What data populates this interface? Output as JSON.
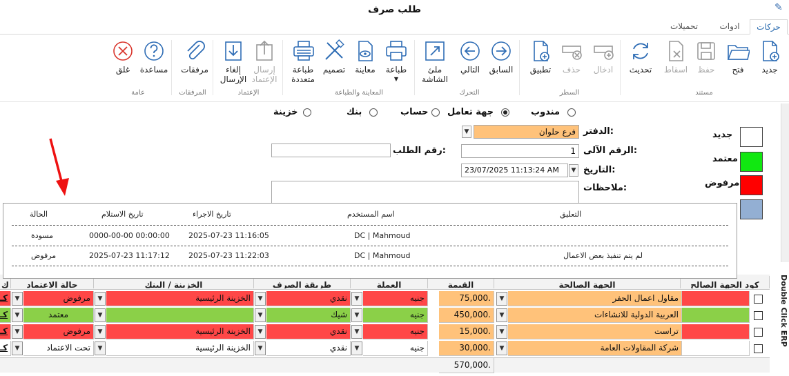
{
  "window": {
    "title": "طلب صرف"
  },
  "tabs": [
    "حركات",
    "ادوات",
    "تحميلات"
  ],
  "ribbon": {
    "buttons": [
      {
        "label": "جديد",
        "icon": "new-document-icon",
        "enabled": true
      },
      {
        "label": "فتح",
        "icon": "folder-open-icon",
        "enabled": true
      },
      {
        "label": "حفظ",
        "icon": "save-icon",
        "enabled": false
      },
      {
        "label": "اسقاط",
        "icon": "discard-icon",
        "enabled": false
      },
      {
        "label": "تحديث",
        "icon": "refresh-icon",
        "enabled": true
      },
      {
        "label": "ادخال",
        "icon": "insert-row-icon",
        "enabled": false
      },
      {
        "label": "حذف",
        "icon": "delete-row-icon",
        "enabled": false
      },
      {
        "label": "تطبيق",
        "icon": "apply-icon",
        "enabled": true
      },
      {
        "label": "السابق",
        "icon": "arrow-right-icon",
        "enabled": true
      },
      {
        "label": "التالي",
        "icon": "arrow-left-icon",
        "enabled": true
      },
      {
        "label": "ملئ\nالشاشة",
        "icon": "fullscreen-icon",
        "enabled": true
      },
      {
        "label": "طباعة",
        "icon": "printer-icon",
        "enabled": true
      },
      {
        "label": "معاينة",
        "icon": "preview-icon",
        "enabled": true
      },
      {
        "label": "تصميم",
        "icon": "design-icon",
        "enabled": true
      },
      {
        "label": "طباعة\nمتعددة",
        "icon": "multi-print-icon",
        "enabled": true
      },
      {
        "label": "إرسال\nالإعتماد",
        "icon": "send-approval-icon",
        "enabled": false
      },
      {
        "label": "إلغاء\nالإرسال",
        "icon": "cancel-send-icon",
        "enabled": true
      },
      {
        "label": "مرفقات",
        "icon": "paperclip-icon",
        "enabled": true
      },
      {
        "label": "مساعدة",
        "icon": "help-icon",
        "enabled": true
      },
      {
        "label": "غلق",
        "icon": "close-icon",
        "enabled": true
      }
    ],
    "groups": [
      "مستند",
      "السطر",
      "التحرك",
      "المعاينة والطباعة",
      "الإعتماد",
      "المرفقات",
      "عامة"
    ]
  },
  "form": {
    "radios": [
      {
        "label": "مندوب",
        "checked": false
      },
      {
        "label": "جهة تعامل",
        "checked": true
      },
      {
        "label": "حساب",
        "checked": false
      },
      {
        "label": "بنك",
        "checked": false
      },
      {
        "label": "خزينة",
        "checked": false
      }
    ],
    "ledger_label": "الدفتر:",
    "ledger_value": "فرع حلوان",
    "auto_no_label": "الرقم الآلى:",
    "auto_no_value": "1",
    "request_no_label": "رقم الطلب:",
    "request_no_value": "",
    "date_label": "التاريخ:",
    "date_value": "23/07/2025 11:13:24 AM",
    "notes_label": "ملاحظات:",
    "notes_value": ""
  },
  "legend": [
    {
      "label": "جديد",
      "color": "#ffffff"
    },
    {
      "label": "معتمد",
      "color": "#11e811"
    },
    {
      "label": "مرفوض",
      "color": "#ff0000"
    },
    {
      "label": "",
      "color": "#93afd3"
    }
  ],
  "popup": {
    "headers": {
      "comment": "التعليق",
      "user": "اسم المستخدم",
      "exec_date": "تاريخ الاجراء",
      "recv_date": "تاريخ الاستلام",
      "status": "الحالة"
    },
    "rows": [
      {
        "comment": "",
        "user": "DC | Mahmoud",
        "exec_date": "2025-07-23 11:16:05",
        "recv_date": "0000-00-00 00:00:00",
        "status": "مسودة"
      },
      {
        "comment": "لم يتم تنفيذ بعض الاعمال",
        "user": "DC | Mahmoud",
        "exec_date": "2025-07-23 11:22:03",
        "recv_date": "2025-07-23 11:17:12",
        "status": "مرفوض"
      }
    ]
  },
  "grid": {
    "headers": {
      "code": "كود الجهة الصالح",
      "party": "الجهة الصالحة",
      "amount": "القيمة",
      "currency": "العملة",
      "pay_method": "طريقة الصرف",
      "treasury": "الخزينة / البنك",
      "approval": "حالة الاعتماد",
      "extra": "ك"
    },
    "rows": [
      {
        "party": "مقاول اعمال الحفر",
        "amount": "75,000.",
        "currency": "جنيه",
        "pay_method": "نقدي",
        "treasury": "الخزينة الرئيسية",
        "approval": "مرفوض",
        "extra": "كـ",
        "color": "red"
      },
      {
        "party": "العربية الدولية للانشاءات",
        "amount": "450,000.",
        "currency": "جنيه",
        "pay_method": "شيك",
        "treasury": "",
        "approval": "معتمد",
        "extra": "كـ",
        "color": "green"
      },
      {
        "party": "تراست",
        "amount": "15,000.",
        "currency": "جنيه",
        "pay_method": "نقدي",
        "treasury": "الخزينة الرئيسية",
        "approval": "مرفوض",
        "extra": "كـ",
        "color": "red"
      },
      {
        "party": "شركة المقاولات العامة",
        "amount": "30,000.",
        "currency": "جنيه",
        "pay_method": "نقدي",
        "treasury": "الخزينة الرئيسية",
        "approval": "تحت الاعتماد",
        "extra": "كـ",
        "color": "white"
      }
    ],
    "total": "570,000."
  },
  "side_text": "Double Click ERP",
  "colors": {
    "accent": "#2b6cb0",
    "red": "#ff4747",
    "green": "#8bd048",
    "orange": "#ffc27a"
  }
}
